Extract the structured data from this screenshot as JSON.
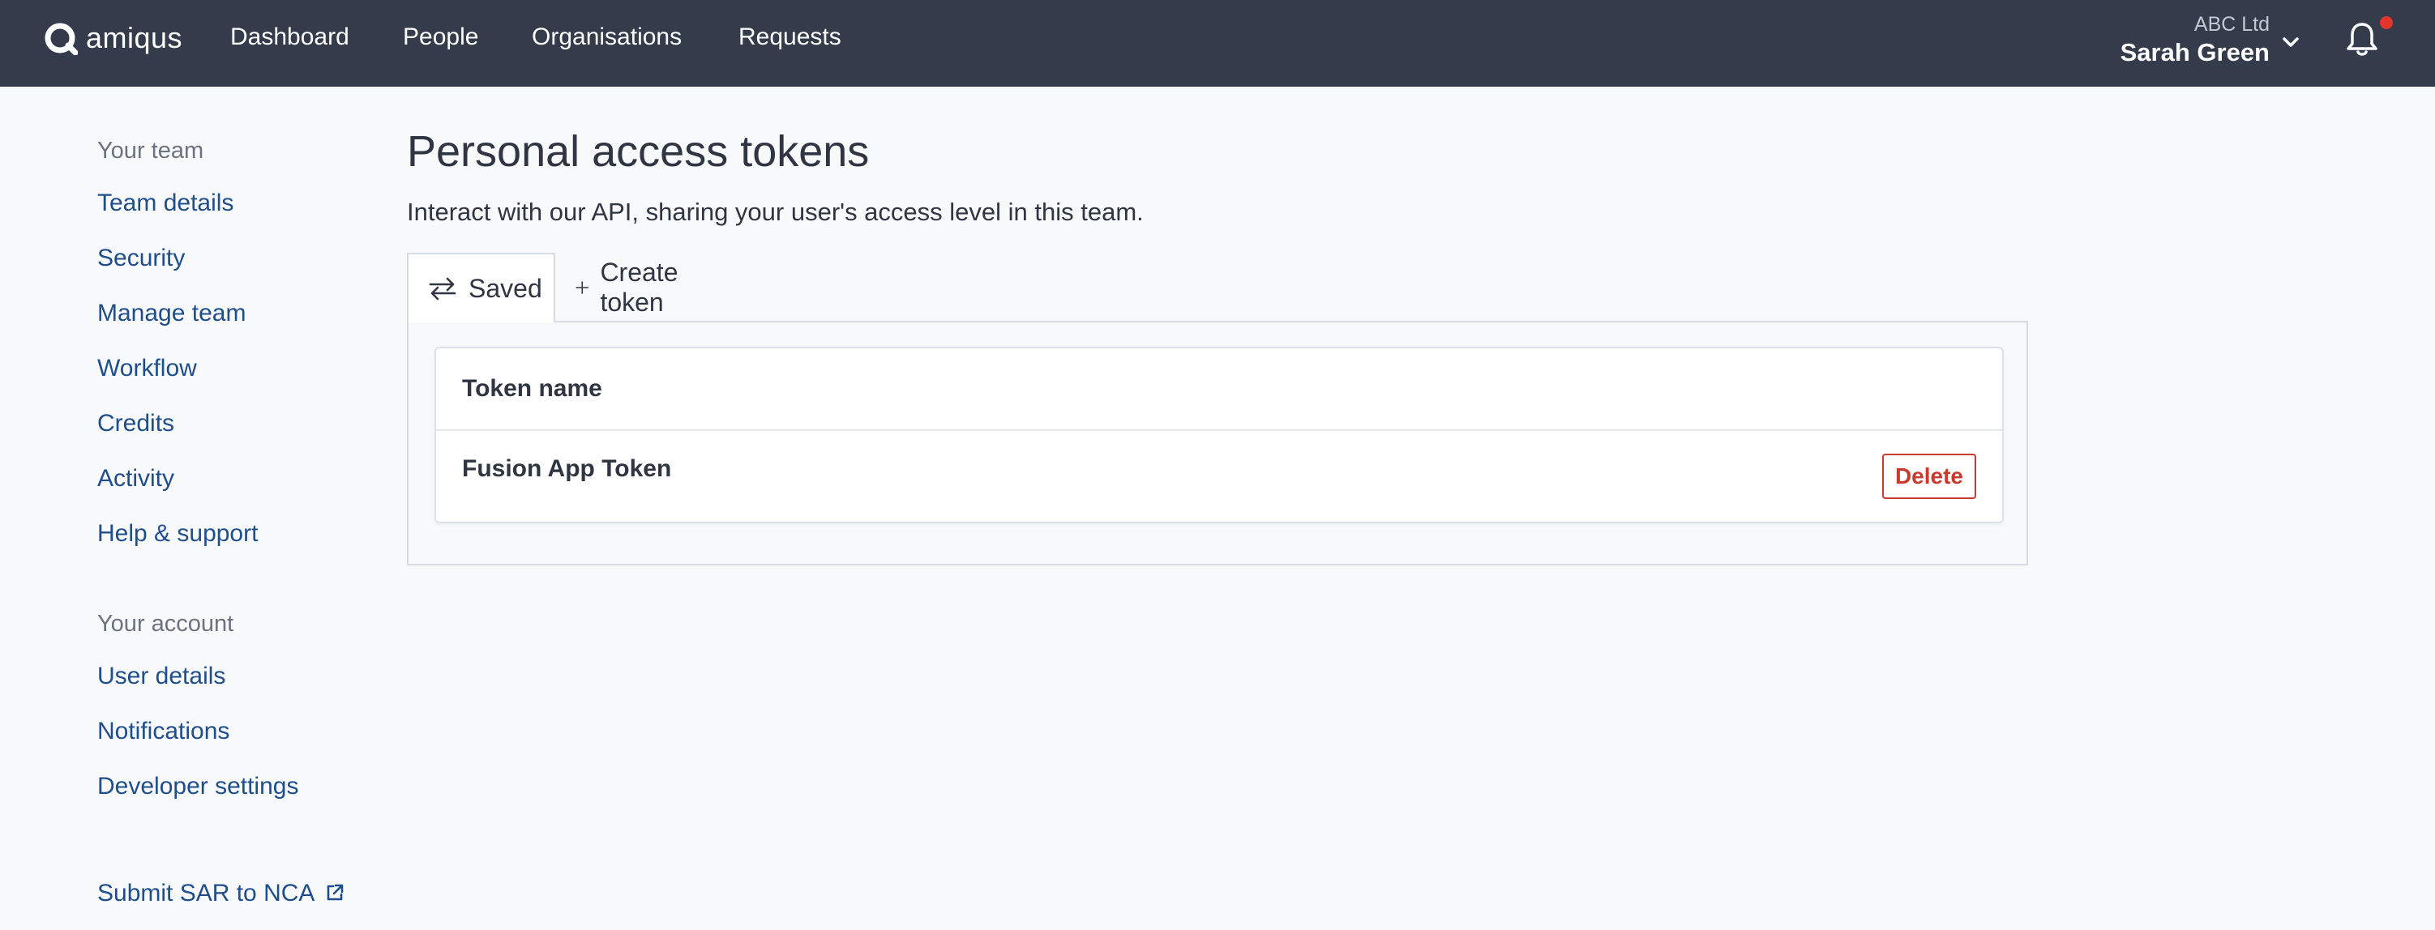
{
  "brand": {
    "name": "amiqus"
  },
  "nav": {
    "items": [
      {
        "label": "Dashboard"
      },
      {
        "label": "People"
      },
      {
        "label": "Organisations"
      },
      {
        "label": "Requests"
      }
    ]
  },
  "account": {
    "org": "ABC Ltd",
    "user": "Sarah Green",
    "notification_dot_color": "#e0362b"
  },
  "sidebar": {
    "team_heading": "Your team",
    "team_items": [
      {
        "label": "Team details"
      },
      {
        "label": "Security"
      },
      {
        "label": "Manage team"
      },
      {
        "label": "Workflow"
      },
      {
        "label": "Credits"
      },
      {
        "label": "Activity"
      },
      {
        "label": "Help & support"
      }
    ],
    "account_heading": "Your account",
    "account_items": [
      {
        "label": "User details"
      },
      {
        "label": "Notifications"
      },
      {
        "label": "Developer settings"
      }
    ],
    "external_link": {
      "label": "Submit SAR to NCA",
      "icon": "external-link-icon"
    }
  },
  "main": {
    "title": "Personal access tokens",
    "subtitle": "Interact with our API, sharing your user's access level in this team.",
    "tabs": [
      {
        "label": "Saved",
        "icon": "swap-arrows-icon",
        "active": true
      },
      {
        "label": "Create token",
        "icon": "plus-icon",
        "active": false
      }
    ],
    "table": {
      "header": "Token name",
      "rows": [
        {
          "name": "Fusion App Token",
          "action": "Delete"
        }
      ]
    }
  },
  "colors": {
    "topbar": "#343b4a",
    "link": "#1f4e8c",
    "danger": "#c93a2c",
    "background": "#f8f9fb"
  }
}
